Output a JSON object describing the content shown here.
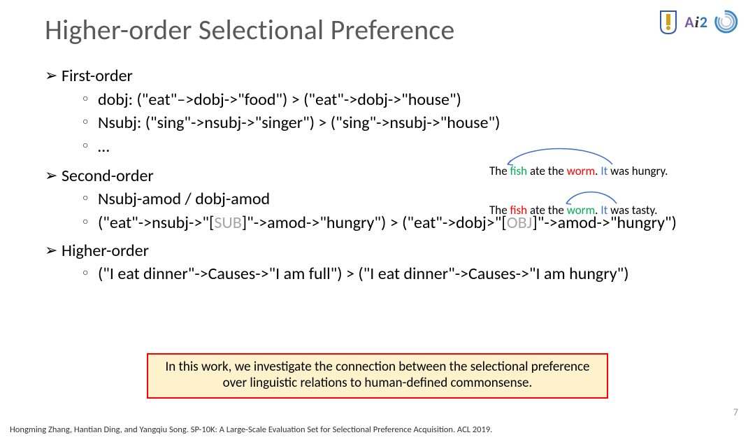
{
  "title": "Higher-order Selectional Preference",
  "logos": {
    "ai2": {
      "a": "A",
      "i": "i",
      "two": "2"
    }
  },
  "bullets": {
    "first": {
      "label": "First-order",
      "items": [
        "dobj: (\"eat\"–>dobj->\"food\") > (\"eat\"->dobj->\"house\")",
        "Nsubj: (\"sing\"->nsubj->\"singer\") > (\"sing\"->nsubj->\"house\")",
        "…"
      ]
    },
    "second": {
      "label": "Second-order",
      "items": [
        "Nsubj-amod / dobj-amod"
      ],
      "complex": {
        "p1": "(\"eat\"->nsubj->\"[",
        "sub": "SUB",
        "p2": "]\"->amod->\"hungry\") > (\"eat\"->dobj>\"[",
        "obj": "OBJ",
        "p3": "]\"->amod->\"hungry\")"
      }
    },
    "higher": {
      "label": "Higher-order",
      "items": [
        "(\"I eat dinner\"->Causes->\"I am full\") > (\"I eat dinner\"->Causes->\"I am hungry\")"
      ]
    }
  },
  "examples": {
    "row1": {
      "pre": "The ",
      "fish": "fish",
      "mid": " ate the ",
      "worm": "worm",
      "dot": ". ",
      "it": "It",
      "post": " was hungry."
    },
    "row2": {
      "pre": "The ",
      "fish": "fish",
      "mid": " ate the ",
      "worm": "worm",
      "dot": ". ",
      "it": "It",
      "post": " was tasty."
    }
  },
  "highlight": "In this work, we investigate the connection between the selectional preference over linguistic relations to human-defined commonsense.",
  "pageNumber": "7",
  "citation": "Hongming Zhang, Hantian Ding, and Yangqiu Song. SP-10K: A Large-Scale Evaluation Set for Selectional Preference Acquisition. ACL 2019."
}
